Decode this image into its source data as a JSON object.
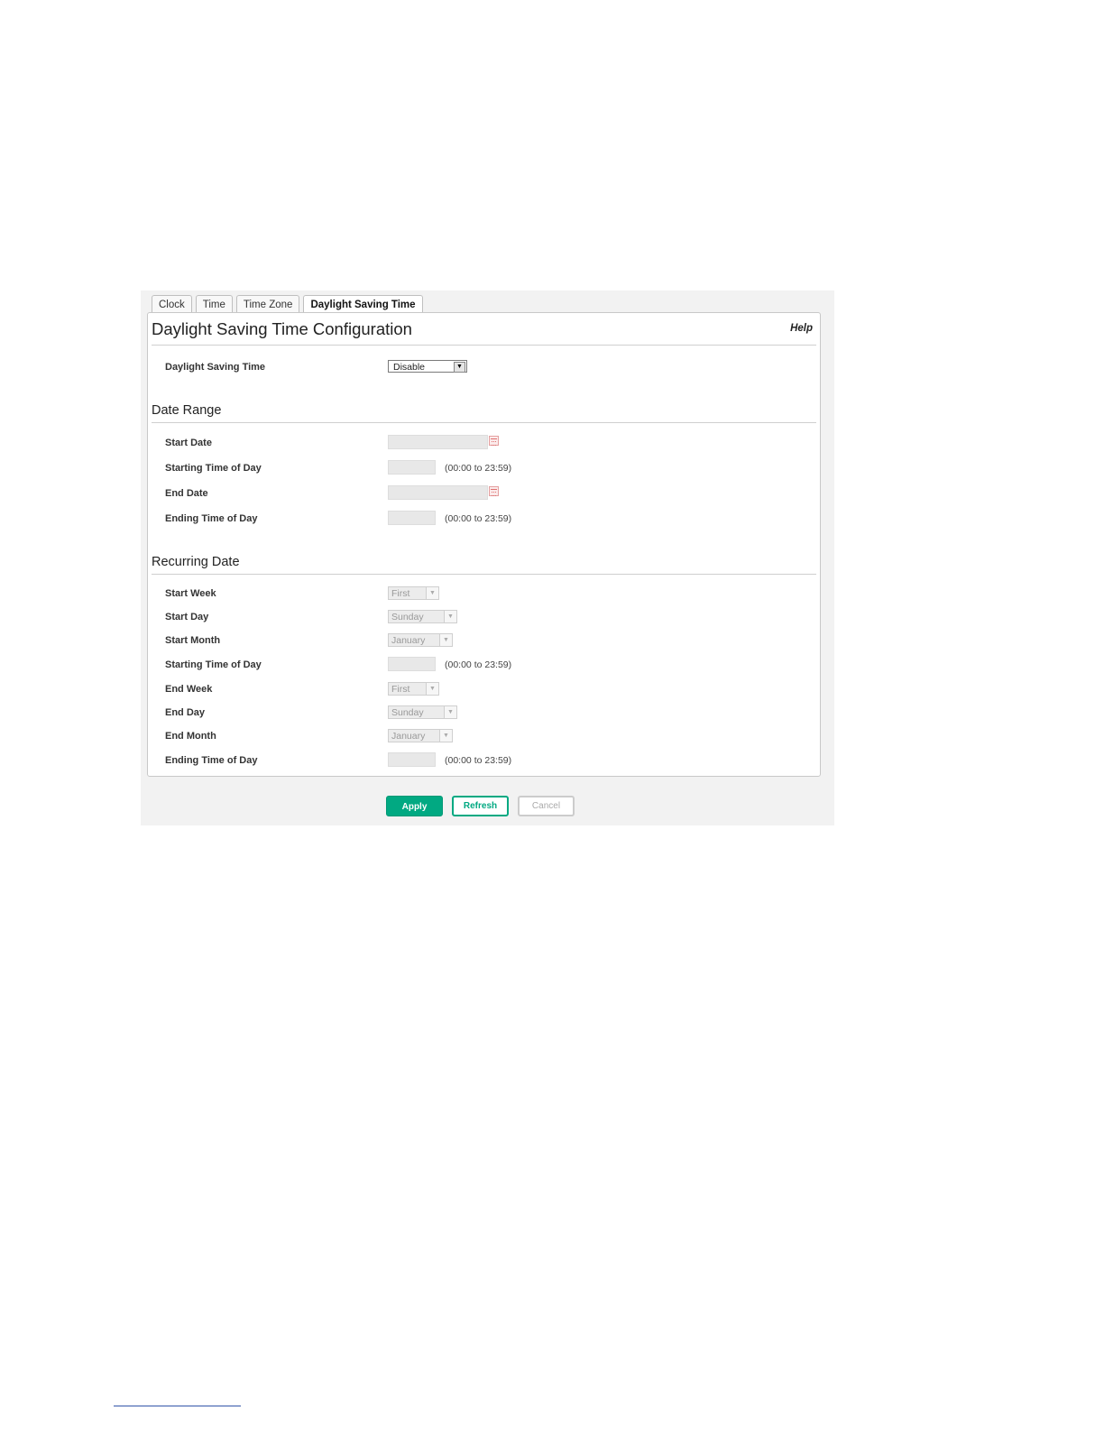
{
  "tabs": [
    "Clock",
    "Time",
    "Time Zone",
    "Daylight Saving Time"
  ],
  "panel": {
    "title": "Daylight Saving Time Configuration",
    "help": "Help"
  },
  "dst": {
    "label": "Daylight Saving Time",
    "value": "Disable"
  },
  "date_range": {
    "heading": "Date Range",
    "start_date": "Start Date",
    "starting_time": "Starting Time of Day",
    "end_date": "End Date",
    "ending_time": "Ending Time of Day",
    "range_hint": "(00:00 to 23:59)"
  },
  "recurring": {
    "heading": "Recurring Date",
    "start_week": {
      "label": "Start Week",
      "value": "First"
    },
    "start_day": {
      "label": "Start Day",
      "value": "Sunday"
    },
    "start_month": {
      "label": "Start Month",
      "value": "January"
    },
    "starting_time": "Starting Time of Day",
    "end_week": {
      "label": "End Week",
      "value": "First"
    },
    "end_day": {
      "label": "End Day",
      "value": "Sunday"
    },
    "end_month": {
      "label": "End Month",
      "value": "January"
    },
    "ending_time": "Ending Time of Day",
    "range_hint": "(00:00 to 23:59)"
  },
  "buttons": {
    "apply": "Apply",
    "refresh": "Refresh",
    "cancel": "Cancel"
  },
  "colors": {
    "accent": "#01a982"
  },
  "icons": {
    "dropdown": "chevron-down-icon",
    "calendar": "calendar-icon"
  }
}
